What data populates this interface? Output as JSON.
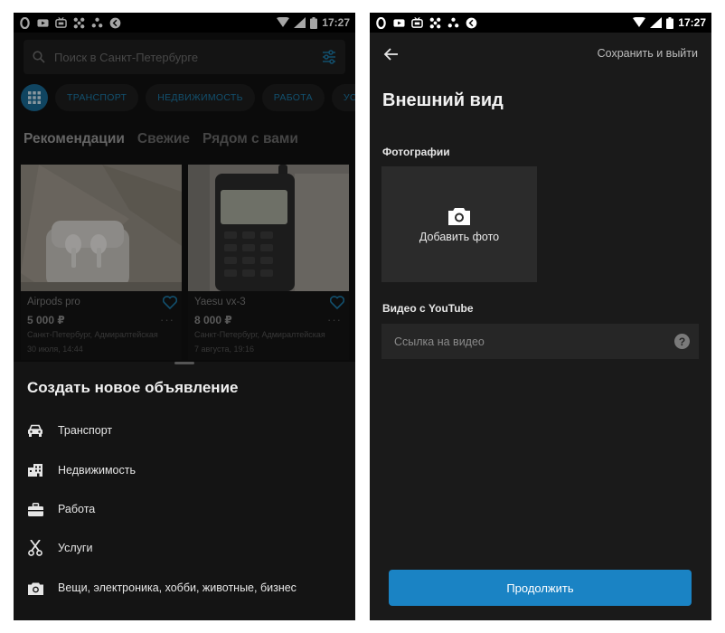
{
  "status_bar": {
    "time": "17:27"
  },
  "left_screen": {
    "search": {
      "placeholder": "Поиск в Санкт-Петербурге"
    },
    "categories": [
      "ТРАНСПОРТ",
      "НЕДВИЖИМОСТЬ",
      "РАБОТА",
      "УСЛУ"
    ],
    "feed_tabs": [
      "Рекомендации",
      "Свежие",
      "Рядом с вами"
    ],
    "listings": [
      {
        "title": "Airpods pro",
        "price": "5 000 ₽",
        "location": "Санкт-Петербург, Адмиралтейская",
        "date": "30 июля, 14:44"
      },
      {
        "title": "Yaesu vx-3",
        "price": "8 000 ₽",
        "location": "Санкт-Петербург, Адмиралтейская",
        "date": "7 августа, 19:16"
      }
    ],
    "sheet": {
      "title": "Создать новое объявление",
      "items": [
        {
          "label": "Транспорт",
          "icon": "car-icon"
        },
        {
          "label": "Недвижимость",
          "icon": "building-icon"
        },
        {
          "label": "Работа",
          "icon": "briefcase-icon"
        },
        {
          "label": "Услуги",
          "icon": "scissors-icon"
        },
        {
          "label": "Вещи, электроника, хобби, животные, бизнес",
          "icon": "camera-icon"
        }
      ]
    }
  },
  "right_screen": {
    "save_exit": "Сохранить и выйти",
    "title": "Внешний вид",
    "photos_label": "Фотографии",
    "add_photo": "Добавить фото",
    "video_label": "Видео с YouTube",
    "video_placeholder": "Ссылка на видео",
    "help_symbol": "?",
    "continue_button": "Продолжить"
  },
  "colors": {
    "accent": "#1a83c4",
    "background": "#121212",
    "chip_text": "#1d7aa8"
  }
}
